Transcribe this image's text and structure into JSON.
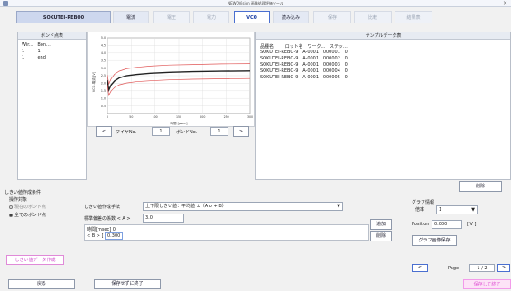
{
  "window": {
    "title": "NEWOVision 画像処理評価ツール",
    "close": "×"
  },
  "tabs": [
    {
      "label": "SOKUTEI-REBO0",
      "state": "active"
    },
    {
      "label": "電流",
      "state": "on"
    },
    {
      "label": "電圧",
      "state": "dim"
    },
    {
      "label": "電力",
      "state": "dim"
    },
    {
      "label": "VCO",
      "state": "vco"
    },
    {
      "label": "読み込み",
      "state": "on"
    },
    {
      "label": "保存",
      "state": "dim"
    },
    {
      "label": "比較",
      "state": "dim"
    },
    {
      "label": "結果表",
      "state": "dim"
    }
  ],
  "bond_panel": {
    "title": "ボンド点表",
    "header": "Wir...   Bon...",
    "rows": [
      "1         1",
      "1         end"
    ]
  },
  "chart": {
    "ylabel": "VCO-電流-[V]",
    "xlabel": "時間 [µsec]"
  },
  "chart_data": {
    "type": "line",
    "xlim": [
      0,
      300
    ],
    "ylim": [
      0,
      5
    ],
    "xticks": [
      "0",
      "50",
      "100",
      "150",
      "200",
      "250",
      "300"
    ],
    "yticks": [
      "5.0",
      "4.5",
      "4.0",
      "3.5",
      "3.0",
      "2.5",
      "2.0",
      "1.5",
      "1.0",
      "0.5"
    ],
    "grid": true,
    "series": [
      {
        "color": "#e05656",
        "x": [
          0,
          3,
          8,
          15,
          25,
          40,
          60,
          90,
          130,
          180,
          240,
          300
        ],
        "y": [
          2.55,
          1.95,
          2.3,
          2.6,
          2.8,
          2.95,
          3.05,
          3.13,
          3.2,
          3.24,
          3.28,
          3.3
        ]
      },
      {
        "color": "#222222",
        "x": [
          0,
          3,
          8,
          15,
          25,
          40,
          60,
          90,
          130,
          180,
          240,
          300
        ],
        "y": [
          2.2,
          1.55,
          1.9,
          2.15,
          2.35,
          2.5,
          2.58,
          2.66,
          2.72,
          2.76,
          2.79,
          2.81
        ]
      },
      {
        "color": "#e05656",
        "x": [
          0,
          3,
          8,
          15,
          25,
          40,
          60,
          90,
          130,
          180,
          240,
          300
        ],
        "y": [
          1.9,
          1.2,
          1.5,
          1.72,
          1.9,
          2.02,
          2.1,
          2.16,
          2.22,
          2.26,
          2.29,
          2.31
        ]
      }
    ]
  },
  "nav": {
    "prev": "<",
    "wire_label": "ワイヤNo.",
    "wire_value": "1",
    "bond_label": "ボンドNo.",
    "bond_value": "1",
    "next": ">"
  },
  "sample_panel": {
    "title": "サンプルデータ表",
    "header": "品種名        ロット名   ワーク...   ステッ...",
    "rows": [
      "SOKUTEI-REBO-9   A-0001   000001   0",
      "SOKUTEI-REBO-9   A-0001   000002   0",
      "SOKUTEI-REBO-9   A-0001   000003   0",
      "SOKUTEI-REBO-9   A-0001   000004   0",
      "SOKUTEI-REBO-9   A-0001   000005   0"
    ],
    "delete": "削除"
  },
  "threshold": {
    "section": "しきい値作成条件",
    "target_label": "操作対象",
    "opt_current": "現在のボンド点",
    "opt_all": "全てのボンド点",
    "method_label": "しきい値作成手法",
    "method_value": "上下限しきい値：平均値 ±（A σ + B）",
    "sigma_label": "標準偏差の係数 < A >",
    "sigma_value": "3.0",
    "time_header": "時間[msec]   0",
    "b_label": "< B > [ V ]",
    "b_value": "0.300",
    "add": "追加",
    "remove": "削除",
    "create": "しきい値データ作成"
  },
  "graph": {
    "section": "グラフ情報",
    "ratio_label": "倍率",
    "ratio_value": "1",
    "position_label": "Position",
    "position_value": "0.000",
    "position_unit": "[ V ]",
    "save_image": "グラフ画像保存"
  },
  "paging": {
    "prev": "<",
    "label": "Page",
    "value": "1 / 2",
    "next": ">"
  },
  "footer": {
    "back": "戻る",
    "close_nosave": "保存せずに終了",
    "save_close": "保存して終了"
  }
}
